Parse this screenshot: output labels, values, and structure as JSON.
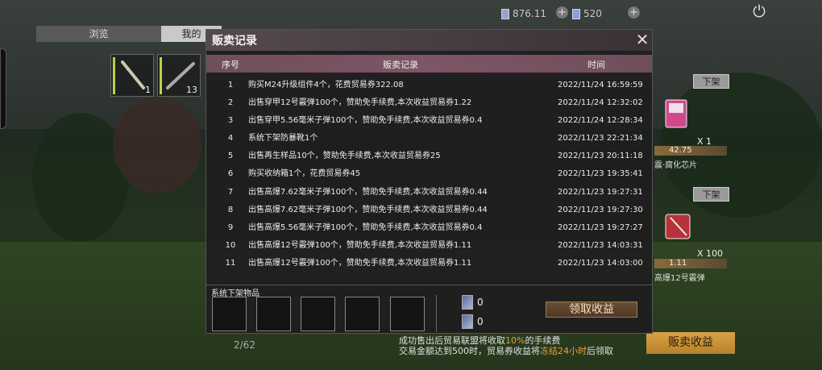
{
  "topbar": {
    "currency1": "876.11",
    "currency2": "520"
  },
  "left_panel": {
    "tab_browse": "浏览",
    "tab_mine": "我的",
    "slot1_count": "1",
    "slot2_count": "13"
  },
  "right_panel": {
    "card1": {
      "button": "下架",
      "qty": "X 1",
      "price": "42.75",
      "name": "震·腐化芯片"
    },
    "card2": {
      "button": "下架",
      "qty": "X 100",
      "price": "1.11",
      "name": "高爆12号霰弹"
    },
    "sell_income_button": "贩卖收益",
    "page": "2/62"
  },
  "modal": {
    "title": "贩卖记录",
    "headers": {
      "num": "序号",
      "record": "贩卖记录",
      "time": "时间"
    },
    "rows": [
      {
        "num": "1",
        "record": "购买M24升级组件4个，花费贸易券322.08",
        "time": "2022/11/24 16:59:59"
      },
      {
        "num": "2",
        "record": "出售穿甲12号霰弹100个，赞助免手续费,本次收益贸易券1.22",
        "time": "2022/11/24 12:32:02"
      },
      {
        "num": "3",
        "record": "出售穿甲5.56毫米子弹100个，赞助免手续费,本次收益贸易券0.4",
        "time": "2022/11/24 12:28:34"
      },
      {
        "num": "4",
        "record": "系统下架防暴靴1个",
        "time": "2022/11/23 22:21:34"
      },
      {
        "num": "5",
        "record": "出售再生样品10个，赞助免手续费,本次收益贸易券25",
        "time": "2022/11/23 20:11:18"
      },
      {
        "num": "6",
        "record": "购买收纳箱1个，花费贸易券45",
        "time": "2022/11/23 19:35:41"
      },
      {
        "num": "7",
        "record": "出售高爆7.62毫米子弹100个，赞助免手续费,本次收益贸易券0.44",
        "time": "2022/11/23 19:27:31"
      },
      {
        "num": "8",
        "record": "出售高爆7.62毫米子弹100个，赞助免手续费,本次收益贸易券0.44",
        "time": "2022/11/23 19:27:30"
      },
      {
        "num": "9",
        "record": "出售高爆5.56毫米子弹100个，赞助免手续费,本次收益贸易券0.4",
        "time": "2022/11/23 19:27:27"
      },
      {
        "num": "10",
        "record": "出售高爆12号霰弹100个，赞助免手续费,本次收益贸易券1.11",
        "time": "2022/11/23 14:03:31"
      },
      {
        "num": "11",
        "record": "出售高爆12号霰弹100个，赞助免手续费,本次收益贸易券1.11",
        "time": "2022/11/23 14:03:00"
      }
    ]
  },
  "bottom": {
    "system_delist_label": "系统下架物品",
    "ticket1_count": "0",
    "ticket2_count": "0",
    "claim_button": "领取收益",
    "notice_line1_pre": "成功售出后贸易联盟将收取",
    "notice_line1_pct": "10%",
    "notice_line1_post": "的手续费",
    "notice_line2_pre": "交易金额达到500时，贸易券收益将",
    "notice_line2_hl": "冻结24小时",
    "notice_line2_post": "后领取"
  }
}
